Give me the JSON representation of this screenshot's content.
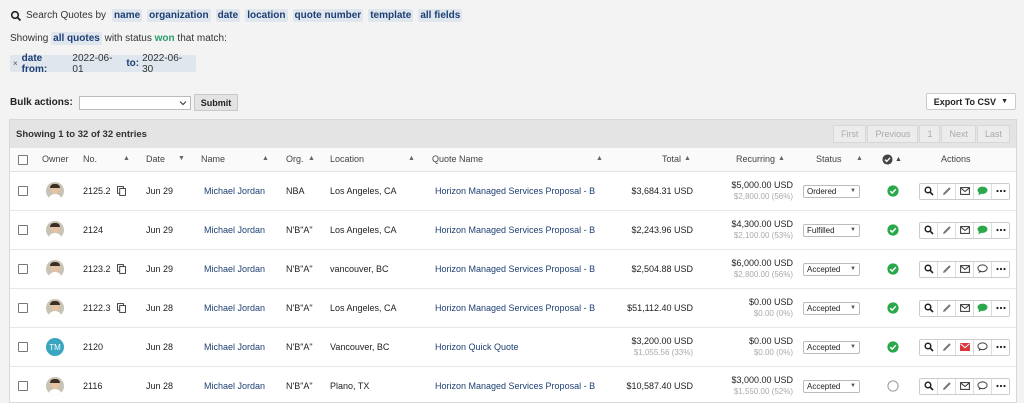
{
  "search": {
    "label": "Search Quotes by",
    "links": [
      "name",
      "organization",
      "date",
      "location",
      "quote number",
      "template",
      "all fields"
    ]
  },
  "showing": {
    "prefix": "Showing",
    "scope": "all quotes",
    "mid": "with status",
    "status": "won",
    "suffix": "that match:"
  },
  "filter": {
    "remove": "×",
    "from_label": "date from:",
    "from_value": "2022-06-01",
    "to_label": "to:",
    "to_value": "2022-06-30"
  },
  "bulk": {
    "label": "Bulk actions:",
    "select_value": "",
    "submit": "Submit"
  },
  "export": {
    "label": "Export To CSV"
  },
  "table": {
    "entries": "Showing 1 to 32 of 32 entries",
    "pager": [
      "First",
      "Previous",
      "1",
      "Next",
      "Last"
    ],
    "columns": {
      "owner": "Owner",
      "no": "No.",
      "date": "Date",
      "name": "Name",
      "org": "Org.",
      "location": "Location",
      "quote": "Quote Name",
      "total": "Total",
      "recurring": "Recurring",
      "status": "Status",
      "actions": "Actions"
    },
    "rows": [
      {
        "owner_kind": "photo",
        "initials": "",
        "no": "2125.2",
        "copy": true,
        "date": "Jun 29",
        "name": "Michael Jordan",
        "org": "NBA",
        "location": "Los Angeles, CA",
        "quote": "Horizon Managed Services Proposal - B",
        "total": "$3,684.31 USD",
        "total_sub": "",
        "rec": "$5,000.00 USD",
        "rec_sub": "$2,800.00 (56%)",
        "status": "Ordered",
        "ok": true,
        "comment_color": "#2aa84a"
      },
      {
        "owner_kind": "photo",
        "initials": "",
        "no": "2124",
        "copy": false,
        "date": "Jun 29",
        "name": "Michael Jordan",
        "org": "N'B\"A\"",
        "location": "Los Angeles, CA",
        "quote": "Horizon Managed Services Proposal - B",
        "total": "$2,243.96 USD",
        "total_sub": "",
        "rec": "$4,300.00 USD",
        "rec_sub": "$2,100.00 (53%)",
        "status": "Fulfilled",
        "ok": true,
        "comment_color": "#2aa84a"
      },
      {
        "owner_kind": "photo",
        "initials": "",
        "no": "2123.2",
        "copy": true,
        "date": "Jun 29",
        "name": "Michael Jordan",
        "org": "N'B\"A\"",
        "location": "vancouver, BC",
        "quote": "Horizon Managed Services Proposal - B",
        "total": "$2,504.88 USD",
        "total_sub": "",
        "rec": "$6,000.00 USD",
        "rec_sub": "$2,800.00 (56%)",
        "status": "Accepted",
        "ok": true,
        "comment_color": ""
      },
      {
        "owner_kind": "photo",
        "initials": "",
        "no": "2122.3",
        "copy": true,
        "date": "Jun 28",
        "name": "Michael Jordan",
        "org": "N'B\"A\"",
        "location": "Los Angeles, CA",
        "quote": "Horizon Managed Services Proposal - B",
        "total": "$51,112.40 USD",
        "total_sub": "",
        "rec": "$0.00 USD",
        "rec_sub": "$0.00 (0%)",
        "status": "Accepted",
        "ok": true,
        "comment_color": "#2aa84a"
      },
      {
        "owner_kind": "initials",
        "initials": "TM",
        "no": "2120",
        "copy": false,
        "date": "Jun 28",
        "name": "Michael Jordan",
        "org": "N'B\"A\"",
        "location": "Vancouver, BC",
        "quote": "Horizon Quick Quote",
        "total": "$3,200.00 USD",
        "total_sub": "$1,055.56 (33%)",
        "rec": "$0.00 USD",
        "rec_sub": "$0.00 (0%)",
        "status": "Accepted",
        "ok": true,
        "comment_color": "",
        "mail_color": "#d9363e"
      },
      {
        "owner_kind": "photo",
        "initials": "",
        "no": "2116",
        "copy": false,
        "date": "Jun 28",
        "name": "Michael Jordan",
        "org": "N'B\"A\"",
        "location": "Plano, TX",
        "quote": "Horizon Managed Services Proposal - B",
        "total": "$10,587.40 USD",
        "total_sub": "",
        "rec": "$3,000.00 USD",
        "rec_sub": "$1,550.00 (52%)",
        "status": "Accepted",
        "ok": false,
        "comment_color": ""
      }
    ]
  },
  "colors": {
    "link": "#1d3f73",
    "won": "#2a9d6a",
    "ok": "#2aa84a",
    "chip_bg": "#dfe6ee"
  }
}
